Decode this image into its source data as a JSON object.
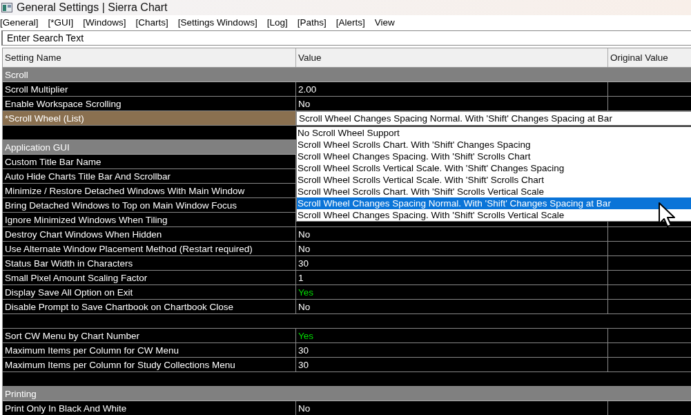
{
  "window": {
    "title": "General Settings | Sierra Chart"
  },
  "menu": [
    "[General]",
    "[*GUI]",
    "[Windows]",
    "[Charts]",
    "[Settings Windows]",
    "[Log]",
    "[Paths]",
    "[Alerts]",
    "View"
  ],
  "search": {
    "placeholder": "Enter Search Text"
  },
  "table": {
    "columns": [
      "Setting Name",
      "Value",
      "Original Value"
    ],
    "rows": [
      {
        "kind": "section",
        "name": "Scroll"
      },
      {
        "kind": "setting",
        "name": "Scroll Multiplier",
        "value": "2.00",
        "selected": false
      },
      {
        "kind": "setting",
        "name": "Enable Workspace Scrolling",
        "value": "No",
        "selected": false
      },
      {
        "kind": "list",
        "name": "*Scroll Wheel (List)",
        "value": "Scroll Wheel Changes Spacing Normal. With 'Shift' Changes Spacing at Bar",
        "selected": true
      },
      {
        "kind": "blank"
      },
      {
        "kind": "section",
        "name": "Application GUI"
      },
      {
        "kind": "setting",
        "name": "Custom Title Bar Name",
        "selected": false
      },
      {
        "kind": "setting",
        "name": "Auto Hide Charts Title Bar And Scrollbar",
        "selected": false
      },
      {
        "kind": "setting",
        "name": "Minimize / Restore Detached Windows With Main Window",
        "selected": false
      },
      {
        "kind": "setting",
        "name": "Bring Detached Windows to Top on Main Window Focus",
        "selected": false
      },
      {
        "kind": "setting",
        "name": "Ignore Minimized Windows When Tiling",
        "selected": false
      },
      {
        "kind": "setting",
        "name": "Destroy Chart Windows When Hidden",
        "value": "No",
        "selected": false
      },
      {
        "kind": "setting",
        "name": "Use Alternate Window Placement Method (Restart required)",
        "value": "No",
        "selected": false
      },
      {
        "kind": "setting",
        "name": "Status Bar Width in Characters",
        "value": "30",
        "selected": false
      },
      {
        "kind": "setting",
        "name": "Small Pixel Amount Scaling Factor",
        "value": "1",
        "selected": false
      },
      {
        "kind": "setting",
        "name": "Display Save All Option on Exit",
        "value": "Yes",
        "color": "#00dd00",
        "selected": false
      },
      {
        "kind": "setting",
        "name": "Disable Prompt to Save Chartbook on Chartbook Close",
        "value": "No",
        "selected": false
      },
      {
        "kind": "blank"
      },
      {
        "kind": "setting",
        "name": "Sort CW Menu by Chart Number",
        "value": "Yes",
        "color": "#00dd00",
        "selected": false
      },
      {
        "kind": "setting",
        "name": "Maximum Items per Column for CW Menu",
        "value": "30",
        "selected": false
      },
      {
        "kind": "setting",
        "name": "Maximum Items per Column for Study Collections Menu",
        "value": "30",
        "selected": false
      },
      {
        "kind": "blank"
      },
      {
        "kind": "section",
        "name": "Printing"
      },
      {
        "kind": "setting",
        "name": "Print Only In Black And White",
        "value": "No",
        "selected": false
      }
    ]
  },
  "dropdown": {
    "options": [
      {
        "label": "No Scroll Wheel Support",
        "selected": false
      },
      {
        "label": "Scroll Wheel Scrolls Chart. With 'Shift' Changes Spacing",
        "selected": false
      },
      {
        "label": "Scroll Wheel Changes Spacing. With 'Shift' Scrolls Chart",
        "selected": false
      },
      {
        "label": "Scroll Wheel Scrolls Vertical Scale. With 'Shift' Changes Spacing",
        "selected": false
      },
      {
        "label": "Scroll Wheel Scrolls Vertical Scale. With 'Shift' Scrolls Chart",
        "selected": false
      },
      {
        "label": "Scroll Wheel Scrolls Chart. With 'Shift' Scrolls Vertical Scale",
        "selected": false
      },
      {
        "label": "Scroll Wheel Changes Spacing Normal. With 'Shift' Changes Spacing at Bar",
        "selected": true
      },
      {
        "label": "Scroll Wheel Changes Spacing. With 'Shift' Scrolls Vertical Scale",
        "selected": false
      }
    ]
  }
}
